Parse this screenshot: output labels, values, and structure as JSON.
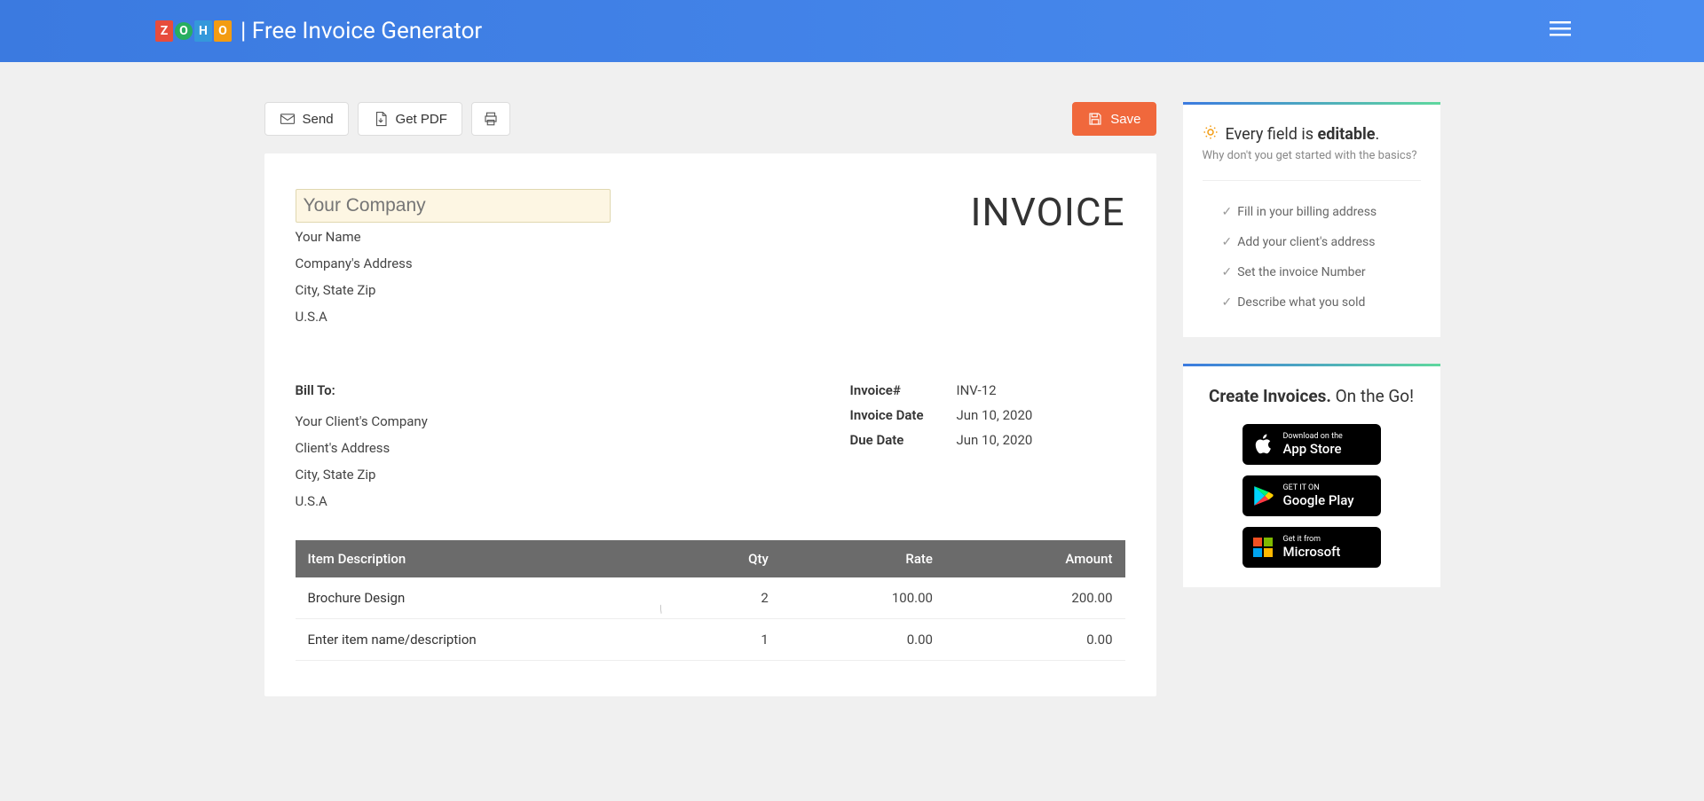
{
  "header": {
    "title": "| Free Invoice Generator"
  },
  "toolbar": {
    "send": "Send",
    "getpdf": "Get PDF",
    "save": "Save"
  },
  "invoice": {
    "company_name_placeholder": "Your Company",
    "your_name": "Your Name",
    "company_address": "Company's Address",
    "city_state_zip": "City, State Zip",
    "country": "U.S.A",
    "title": "INVOICE",
    "bill_to_label": "Bill To:",
    "client_company": "Your Client's Company",
    "client_address": "Client's Address",
    "client_csz": "City, State Zip",
    "client_country": "U.S.A",
    "meta": {
      "invoice_num_label": "Invoice#",
      "invoice_num": "INV-12",
      "invoice_date_label": "Invoice Date",
      "invoice_date": "Jun 10, 2020",
      "due_date_label": "Due Date",
      "due_date": "Jun 10, 2020"
    },
    "columns": {
      "desc": "Item Description",
      "qty": "Qty",
      "rate": "Rate",
      "amount": "Amount"
    },
    "items": [
      {
        "desc": "Brochure Design",
        "qty": "2",
        "rate": "100.00",
        "amount": "200.00"
      }
    ],
    "placeholder_item": {
      "desc": "Enter item name/description",
      "qty": "1",
      "rate": "0.00",
      "amount": "0.00"
    }
  },
  "sidebar": {
    "tip_prefix": "Every field is ",
    "tip_bold": "editable",
    "tip_suffix": ".",
    "tip_sub": "Why don't you get started with the basics?",
    "tips": [
      "Fill in your billing address",
      "Add your client's address",
      "Set the invoice Number",
      "Describe what you sold"
    ],
    "onthego_prefix": "Create Invoices. ",
    "onthego_suffix": "On the Go!",
    "stores": {
      "apple_small": "Download on the",
      "apple_big": "App Store",
      "google_small": "GET IT ON",
      "google_big": "Google Play",
      "ms_small": "Get it from",
      "ms_big": "Microsoft"
    }
  }
}
